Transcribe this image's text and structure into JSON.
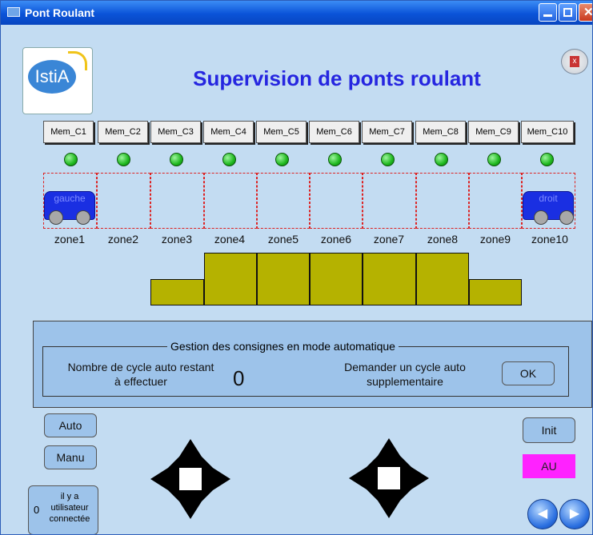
{
  "window": {
    "title": "Pont Roulant"
  },
  "header": {
    "title": "Supervision de ponts roulant",
    "logo_text": "IstiA"
  },
  "memory_buttons": [
    "Mem_C1",
    "Mem_C2",
    "Mem_C3",
    "Mem_C4",
    "Mem_C5",
    "Mem_C6",
    "Mem_C7",
    "Mem_C8",
    "Mem_C9",
    "Mem_C10"
  ],
  "zones": [
    "zone1",
    "zone2",
    "zone3",
    "zone4",
    "zone5",
    "zone6",
    "zone7",
    "zone8",
    "zone9",
    "zone10"
  ],
  "carts": {
    "left_label": "gauche",
    "right_label": "droit"
  },
  "levels": [
    0,
    0,
    1,
    2,
    2,
    2,
    2,
    2,
    1,
    0
  ],
  "auto_panel": {
    "title": "Gestion des consignes en mode automatique",
    "remaining_label_1": "Nombre de cycle auto restant",
    "remaining_label_2": "à effectuer",
    "remaining_value": "0",
    "request_label_1": "Demander un cycle auto",
    "request_label_2": "supplementaire",
    "ok_label": "OK"
  },
  "controls": {
    "auto_label": "Auto",
    "manu_label": "Manu",
    "init_label": "Init",
    "au_label": "AU"
  },
  "users": {
    "count": "0",
    "line1": "il y a",
    "line2": "utilisateur",
    "line3": "connectée"
  },
  "colors": {
    "led": "#1fb81f",
    "cart": "#1a2fe2",
    "stack": "#b5b200",
    "au": "#ff22ff",
    "title": "#2626e0"
  }
}
